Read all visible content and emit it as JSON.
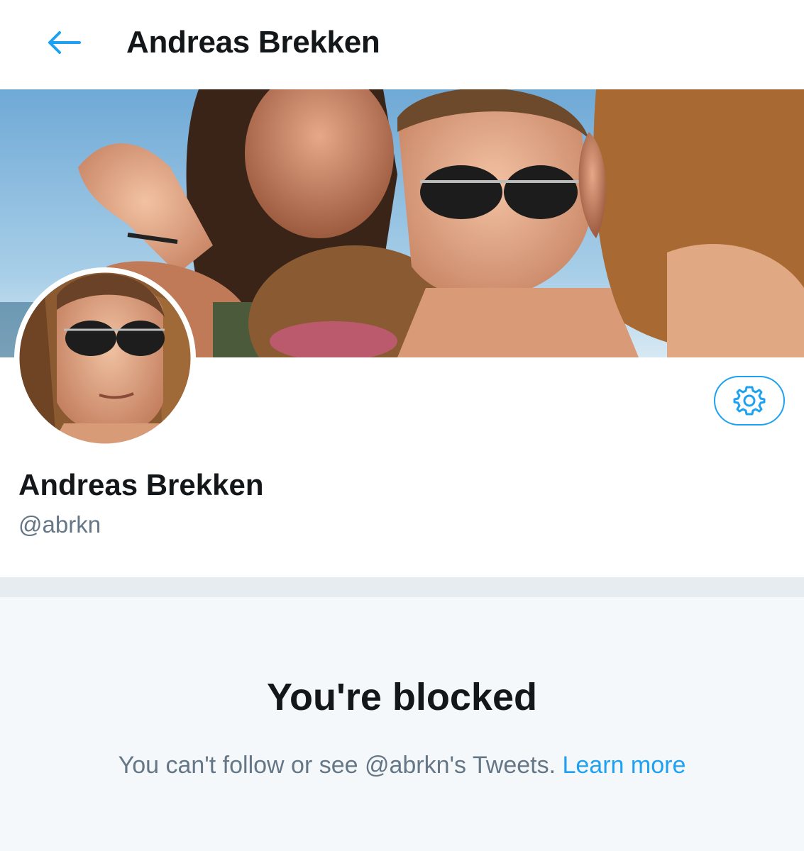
{
  "header": {
    "title": "Andreas Brekken",
    "back_icon": "arrow-left-icon"
  },
  "profile": {
    "display_name": "Andreas Brekken",
    "handle": "@abrkn",
    "settings_icon": "gear-icon"
  },
  "blocked": {
    "title": "You're blocked",
    "message": "You can't follow or see @abrkn's Tweets.",
    "link_text": "Learn more"
  },
  "colors": {
    "accent": "#1da1f2",
    "text_primary": "#14171a",
    "text_secondary": "#657786",
    "divider": "#e6ecf0",
    "blocked_bg": "#f5f8fa"
  }
}
